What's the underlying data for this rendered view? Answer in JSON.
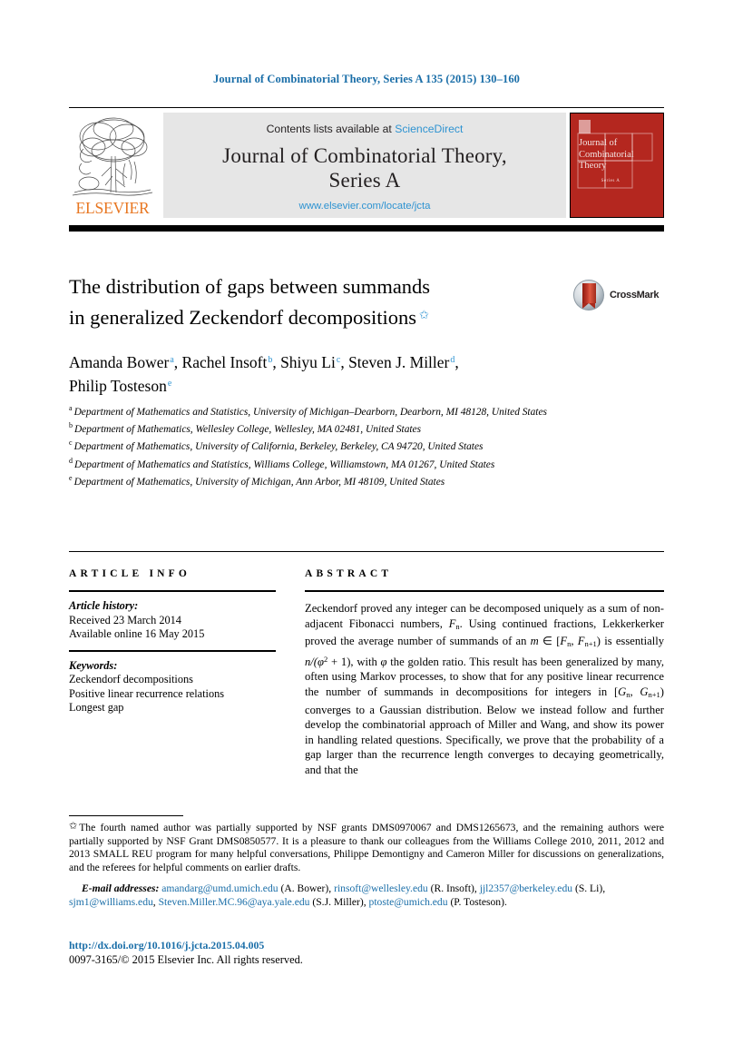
{
  "running_head": "Journal of Combinatorial Theory, Series A 135 (2015) 130–160",
  "banner": {
    "contents_prefix": "Contents lists available at",
    "sciencedirect": "ScienceDirect",
    "journal_title_line1": "Journal of Combinatorial Theory,",
    "journal_title_line2": "Series A",
    "journal_url": "www.elsevier.com/locate/jcta",
    "publisher_wordmark": "ELSEVIER",
    "cover": {
      "title": "Journal of Combinatorial Theory",
      "series": "Series A"
    },
    "colors": {
      "link": "#2e93d1",
      "banner_bg": "#e6e6e6",
      "cover_red": "#b4271f",
      "elsevier_orange": "#e87722"
    }
  },
  "article": {
    "title_line1": "The distribution of gaps between summands",
    "title_line2": "in generalized Zeckendorf decompositions",
    "title_footnote_marker": "✩",
    "crossmark_label": "CrossMark",
    "authors": [
      {
        "name": "Amanda Bower",
        "marker": "a",
        "sep": ", "
      },
      {
        "name": "Rachel Insoft",
        "marker": "b",
        "sep": ", "
      },
      {
        "name": "Shiyu Li",
        "marker": "c",
        "sep": ", "
      },
      {
        "name": "Steven J. Miller",
        "marker": "d",
        "sep": ","
      },
      {
        "name": "Philip Tosteson",
        "marker": "e",
        "sep": ""
      }
    ],
    "affiliations": [
      {
        "marker": "a",
        "text": "Department of Mathematics and Statistics, University of Michigan–Dearborn, Dearborn, MI 48128, United States"
      },
      {
        "marker": "b",
        "text": "Department of Mathematics, Wellesley College, Wellesley, MA 02481, United States"
      },
      {
        "marker": "c",
        "text": "Department of Mathematics, University of California, Berkeley, Berkeley, CA 94720, United States"
      },
      {
        "marker": "d",
        "text": "Department of Mathematics and Statistics, Williams College, Williamstown, MA 01267, United States"
      },
      {
        "marker": "e",
        "text": "Department of Mathematics, University of Michigan, Ann Arbor, MI 48109, United States"
      }
    ]
  },
  "info": {
    "heading": "ARTICLE INFO",
    "history_label": "Article history:",
    "received": "Received 23 March 2014",
    "available_online": "Available online 16 May 2015",
    "keywords_label": "Keywords:",
    "keywords": [
      "Zeckendorf decompositions",
      "Positive linear recurrence relations",
      "Longest gap"
    ]
  },
  "abstract": {
    "heading": "ABSTRACT",
    "text_part1": "Zeckendorf proved any integer can be decomposed uniquely as a sum of non-adjacent Fibonacci numbers, ",
    "fib_symbol": "F",
    "fib_sub": "n",
    "text_part2": ". Using continued fractions, Lekkerkerker proved the average number of summands of an ",
    "m_symbol": "m",
    "in_symbol": " ∈ [",
    "interval1_a": "F",
    "interval1_a_sub": "n",
    "interval1_sep": ", ",
    "interval1_b": "F",
    "interval1_b_sub": "n+1",
    "interval1_close": ") ",
    "text_part3": "is essentially ",
    "formula": "n/(φ",
    "formula_sup": "2",
    "formula_tail": " + 1)",
    "text_part4": ", with ",
    "phi": "φ",
    "text_part5": " the golden ratio. This result has been generalized by many, often using Markov processes, to show that for any positive linear recurrence the number of summands in decompositions for integers in [",
    "interval2_a": "G",
    "interval2_a_sub": "n",
    "interval2_sep": ", ",
    "interval2_b": "G",
    "interval2_b_sub": "n+1",
    "interval2_close": ") ",
    "text_part6": "converges to a Gaussian distribution. Below we instead follow and further develop the combinatorial approach of Miller and Wang, and show its power in handling related questions. Specifically, we prove that the probability of a gap larger than the recurrence length converges to decaying geometrically, and that the"
  },
  "footnote": {
    "marker": "✩",
    "text": "The fourth named author was partially supported by NSF grants DMS0970067 and DMS1265673, and the remaining authors were partially supported by NSF Grant DMS0850577. It is a pleasure to thank our colleagues from the Williams College 2010, 2011, 2012 and 2013 SMALL REU program for many helpful conversations, Philippe Demontigny and Cameron Miller for discussions on generalizations, and the referees for helpful comments on earlier drafts."
  },
  "emails": {
    "label": "E-mail addresses:",
    "entries": [
      {
        "address": "amandarg@umd.umich.edu",
        "owner": "(A. Bower),",
        "trail": " "
      },
      {
        "address": "rinsoft@wellesley.edu",
        "owner": "(R. Insoft),",
        "trail": " "
      },
      {
        "address": "jjl2357@berkeley.edu",
        "owner": "(S. Li),",
        "trail": " "
      },
      {
        "address": "sjm1@williams.edu",
        "owner": ",",
        "trail": " "
      },
      {
        "address": "Steven.Miller.MC.96@aya.yale.edu",
        "owner": "(S.J. Miller),",
        "trail": " "
      },
      {
        "address": "ptoste@umich.edu",
        "owner": "(P. Tosteson).",
        "trail": ""
      }
    ]
  },
  "footer": {
    "doi": "http://dx.doi.org/10.1016/j.jcta.2015.04.005",
    "copyright": "0097-3165/© 2015 Elsevier Inc. All rights reserved."
  }
}
